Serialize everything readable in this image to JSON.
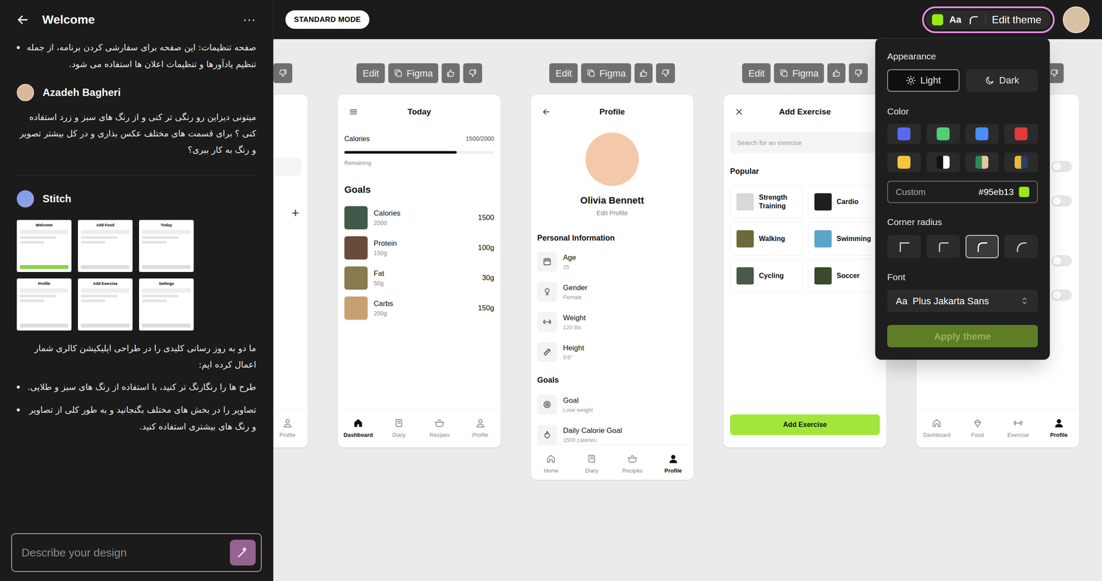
{
  "sidebar": {
    "title": "Welcome",
    "menu": "⋯",
    "earlier_bullet": "صفحه تنظیمات: این صفحه برای سفارشی کردن برنامه، از جمله تنظیم یادآورها و تنظیمات اعلان ها استفاده می شود.",
    "user": {
      "author": "Azadeh Bagheri",
      "text": "میتونی دیزاین رو رنگی تر کنی و از رنگ های سبز و زرد استفاده کنی ؟ برای قسمت های مختلف عکس بذاری و در کل بیشتر تصویر و رنگ به کار ببری؟"
    },
    "assistant": {
      "author": "Stitch",
      "thumbnails": [
        {
          "title": "Welcome"
        },
        {
          "title": "Add Food"
        },
        {
          "title": "Today"
        },
        {
          "title": "Profile"
        },
        {
          "title": "Add Exercise"
        },
        {
          "title": "Settings"
        }
      ],
      "text": "ما دو به روز رسانی کلیدی را در طراحی اپلیکیشن کالری شمار اعمال کرده ایم:",
      "bullets": [
        "طرح ها را رنگارنگ تر کنید، با استفاده از رنگ های سبز و طلایی.",
        "تصاویر را در بخش های مختلف بگنجانید و به طور کلی از تصاویر و رنگ های بیشتری استفاده کنید."
      ]
    },
    "input": {
      "placeholder": "Describe your design"
    }
  },
  "topbar": {
    "mode": "STANDARD MODE",
    "theme": {
      "swatch": "#95eb13",
      "font_sample": "Aa",
      "label": "Edit theme"
    }
  },
  "theme_menu": {
    "appearance": {
      "label": "Appearance",
      "options": [
        {
          "label": "Light",
          "selected": true
        },
        {
          "label": "Dark",
          "selected": false
        }
      ]
    },
    "color": {
      "label": "Color",
      "swatches": [
        {
          "color": "#5b68f2",
          "selected": false
        },
        {
          "color": "#4fce76",
          "selected": false
        },
        {
          "color": "#4b8ef5",
          "selected": false
        },
        {
          "color": "#e03a3a",
          "selected": false
        },
        {
          "color": "#f5c542",
          "selected": false
        },
        {
          "color": "#111111",
          "color2": "#ffffff",
          "selected": false
        },
        {
          "color": "#2f8a57",
          "color2": "#e0c8a0",
          "selected": false
        },
        {
          "color": "#e8b93a",
          "color2": "#2d3e66",
          "selected": false
        }
      ],
      "custom": {
        "label": "Custom",
        "value": "#95eb13",
        "selected": true
      }
    },
    "corner_radius": {
      "label": "Corner radius",
      "options": [
        {
          "selected": false
        },
        {
          "selected": false
        },
        {
          "selected": true
        },
        {
          "selected": false
        }
      ]
    },
    "font": {
      "label": "Font",
      "sample": "Aa",
      "value": "Plus Jakarta Sans"
    },
    "apply": {
      "label": "Apply theme",
      "disabled": true
    }
  },
  "screens": [
    {
      "kind": "add_food",
      "toolbar": {},
      "add": "+",
      "nav": [
        {
          "label": "Profile",
          "selected": false
        }
      ]
    },
    {
      "kind": "today",
      "toolbar": {
        "edit": "Edit",
        "figma": "Figma"
      },
      "title": "Today",
      "calories": {
        "label": "Calories",
        "reading": "1500/2000",
        "level": 0.75,
        "note": "Remaining"
      },
      "goals_title": "Goals",
      "goals": [
        {
          "name": "Calories",
          "target": "2000",
          "value": "1500"
        },
        {
          "name": "Protein",
          "target": "150g",
          "value": "100g"
        },
        {
          "name": "Fat",
          "target": "50g",
          "value": "30g"
        },
        {
          "name": "Carbs",
          "target": "200g",
          "value": "150g"
        }
      ],
      "nav": [
        {
          "label": "Dashboard",
          "selected": true
        },
        {
          "label": "Diary",
          "selected": false
        },
        {
          "label": "Recipes",
          "selected": false
        },
        {
          "label": "Profile",
          "selected": false
        }
      ]
    },
    {
      "kind": "profile",
      "toolbar": {
        "edit": "Edit",
        "figma": "Figma"
      },
      "title": "Profile",
      "name": "Olivia Bennett",
      "edit": "Edit Profile",
      "info_title": "Personal Information",
      "info": [
        {
          "label": "Age",
          "value": "25"
        },
        {
          "label": "Gender",
          "value": "Female"
        },
        {
          "label": "Weight",
          "value": "120 lbs"
        },
        {
          "label": "Height",
          "value": "5'6\""
        }
      ],
      "goals_title": "Goals",
      "goals": [
        {
          "label": "Goal",
          "value": "Lose weight"
        },
        {
          "label": "Daily Calorie Goal",
          "value": "1500 calories"
        }
      ],
      "nav": [
        {
          "label": "Home",
          "selected": false
        },
        {
          "label": "Diary",
          "selected": false
        },
        {
          "label": "Recipes",
          "selected": false
        },
        {
          "label": "Profile",
          "selected": true
        }
      ]
    },
    {
      "kind": "add_exercise",
      "toolbar": {
        "edit": "Edit",
        "figma": "Figma"
      },
      "title": "Add Exercise",
      "search": {
        "placeholder": "Search for an exercise"
      },
      "popular_title": "Popular",
      "exercises": [
        {
          "name": "Strength Training"
        },
        {
          "name": "Cardio"
        },
        {
          "name": "Walking"
        },
        {
          "name": "Swimming"
        },
        {
          "name": "Cycling"
        },
        {
          "name": "Soccer"
        }
      ],
      "button": "Add Exercise"
    },
    {
      "kind": "settings",
      "toolbar": {},
      "toggles": [
        {
          "on": false
        },
        {
          "on": false
        },
        {
          "on": false
        },
        {
          "on": false
        }
      ],
      "nav": [
        {
          "label": "Dashboard",
          "selected": false
        },
        {
          "label": "Food",
          "selected": false
        },
        {
          "label": "Exercise",
          "selected": false
        },
        {
          "label": "Profile",
          "selected": true
        }
      ]
    }
  ]
}
